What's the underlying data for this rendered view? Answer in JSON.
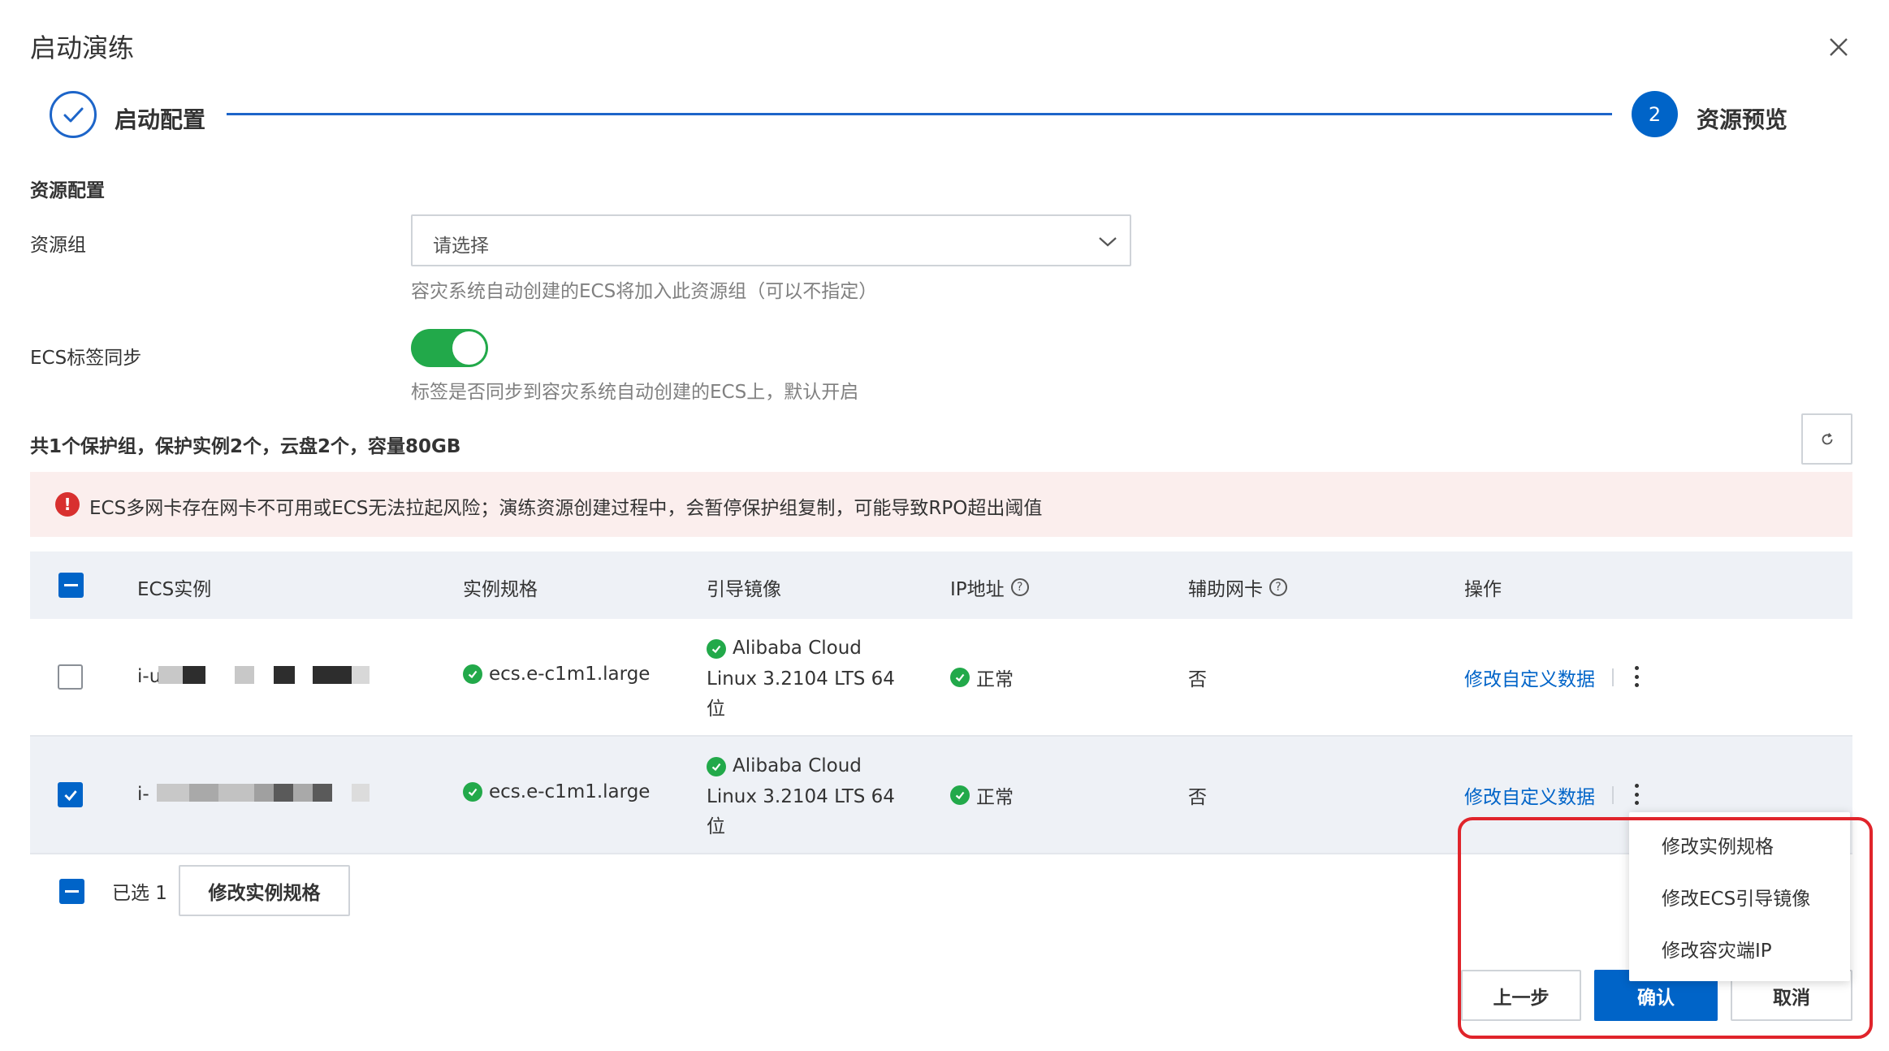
{
  "dialog": {
    "title": "启动演练"
  },
  "steps": [
    {
      "label": "启动配置",
      "status": "done"
    },
    {
      "number": "2",
      "label": "资源预览",
      "status": "current"
    }
  ],
  "resource_config": {
    "section_title": "资源配置",
    "resource_group": {
      "label": "资源组",
      "placeholder": "请选择",
      "help": "容灾系统自动创建的ECS将加入此资源组（可以不指定）"
    },
    "tag_sync": {
      "label": "ECS标签同步",
      "enabled": true,
      "help": "标签是否同步到容灾系统自动创建的ECS上，默认开启"
    }
  },
  "summary": "共1个保护组，保护实例2个，云盘2个，容量80GB",
  "alert": {
    "text": "ECS多网卡存在网卡不可用或ECS无法拉起风险；演练资源创建过程中，会暂停保护组复制，可能导致RPO超出阈值"
  },
  "table": {
    "columns": [
      "ECS实例",
      "实例规格",
      "引导镜像",
      "IP地址",
      "辅助网卡",
      "操作"
    ],
    "rows": [
      {
        "checked": false,
        "instance_prefix": "i-u",
        "spec": "ecs.e-c1m1.large",
        "image_line1": "Alibaba Cloud",
        "image_line2": "Linux 3.2104 LTS 64",
        "image_line3": "位",
        "ip_status": "正常",
        "aux_nic": "否",
        "action": "修改自定义数据"
      },
      {
        "checked": true,
        "instance_prefix": "i-",
        "spec": "ecs.e-c1m1.large",
        "image_line1": "Alibaba Cloud",
        "image_line2": "Linux 3.2104 LTS 64",
        "image_line3": "位",
        "ip_status": "正常",
        "aux_nic": "否",
        "action": "修改自定义数据"
      }
    ]
  },
  "footer": {
    "selected_text": "已选 1",
    "modify_spec_button": "修改实例规格",
    "prev_button": "上一步",
    "confirm_button": "确认",
    "cancel_button": "取消"
  },
  "dropdown_menu": {
    "items": [
      "修改实例规格",
      "修改ECS引导镜像",
      "修改容灾端IP"
    ]
  },
  "colors": {
    "primary": "#0064c8",
    "success": "#22a94a",
    "danger": "#d8302f",
    "alert_bg": "#fbeeed",
    "highlight_border": "#e0242b"
  }
}
